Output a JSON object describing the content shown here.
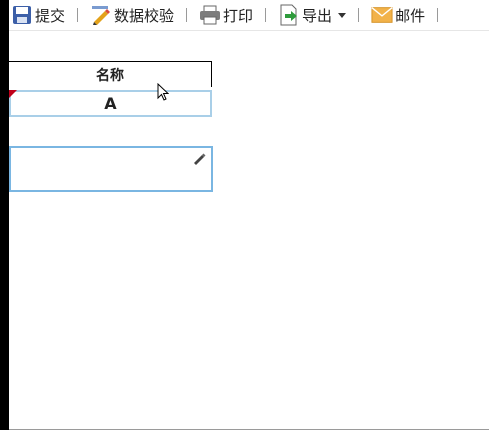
{
  "toolbar": {
    "items": [
      {
        "label": "提交",
        "icon": "save-icon"
      },
      {
        "label": "数据校验",
        "icon": "data-check-icon"
      },
      {
        "label": "打印",
        "icon": "printer-icon"
      },
      {
        "label": "导出",
        "icon": "export-icon"
      },
      {
        "label": "邮件",
        "icon": "mail-icon"
      }
    ]
  },
  "table": {
    "header": "名称",
    "value": "A",
    "input_value": ""
  },
  "colors": {
    "cell_border": "#a9cfe8",
    "input_border": "#7ab6e2",
    "marker": "#c0001a"
  }
}
